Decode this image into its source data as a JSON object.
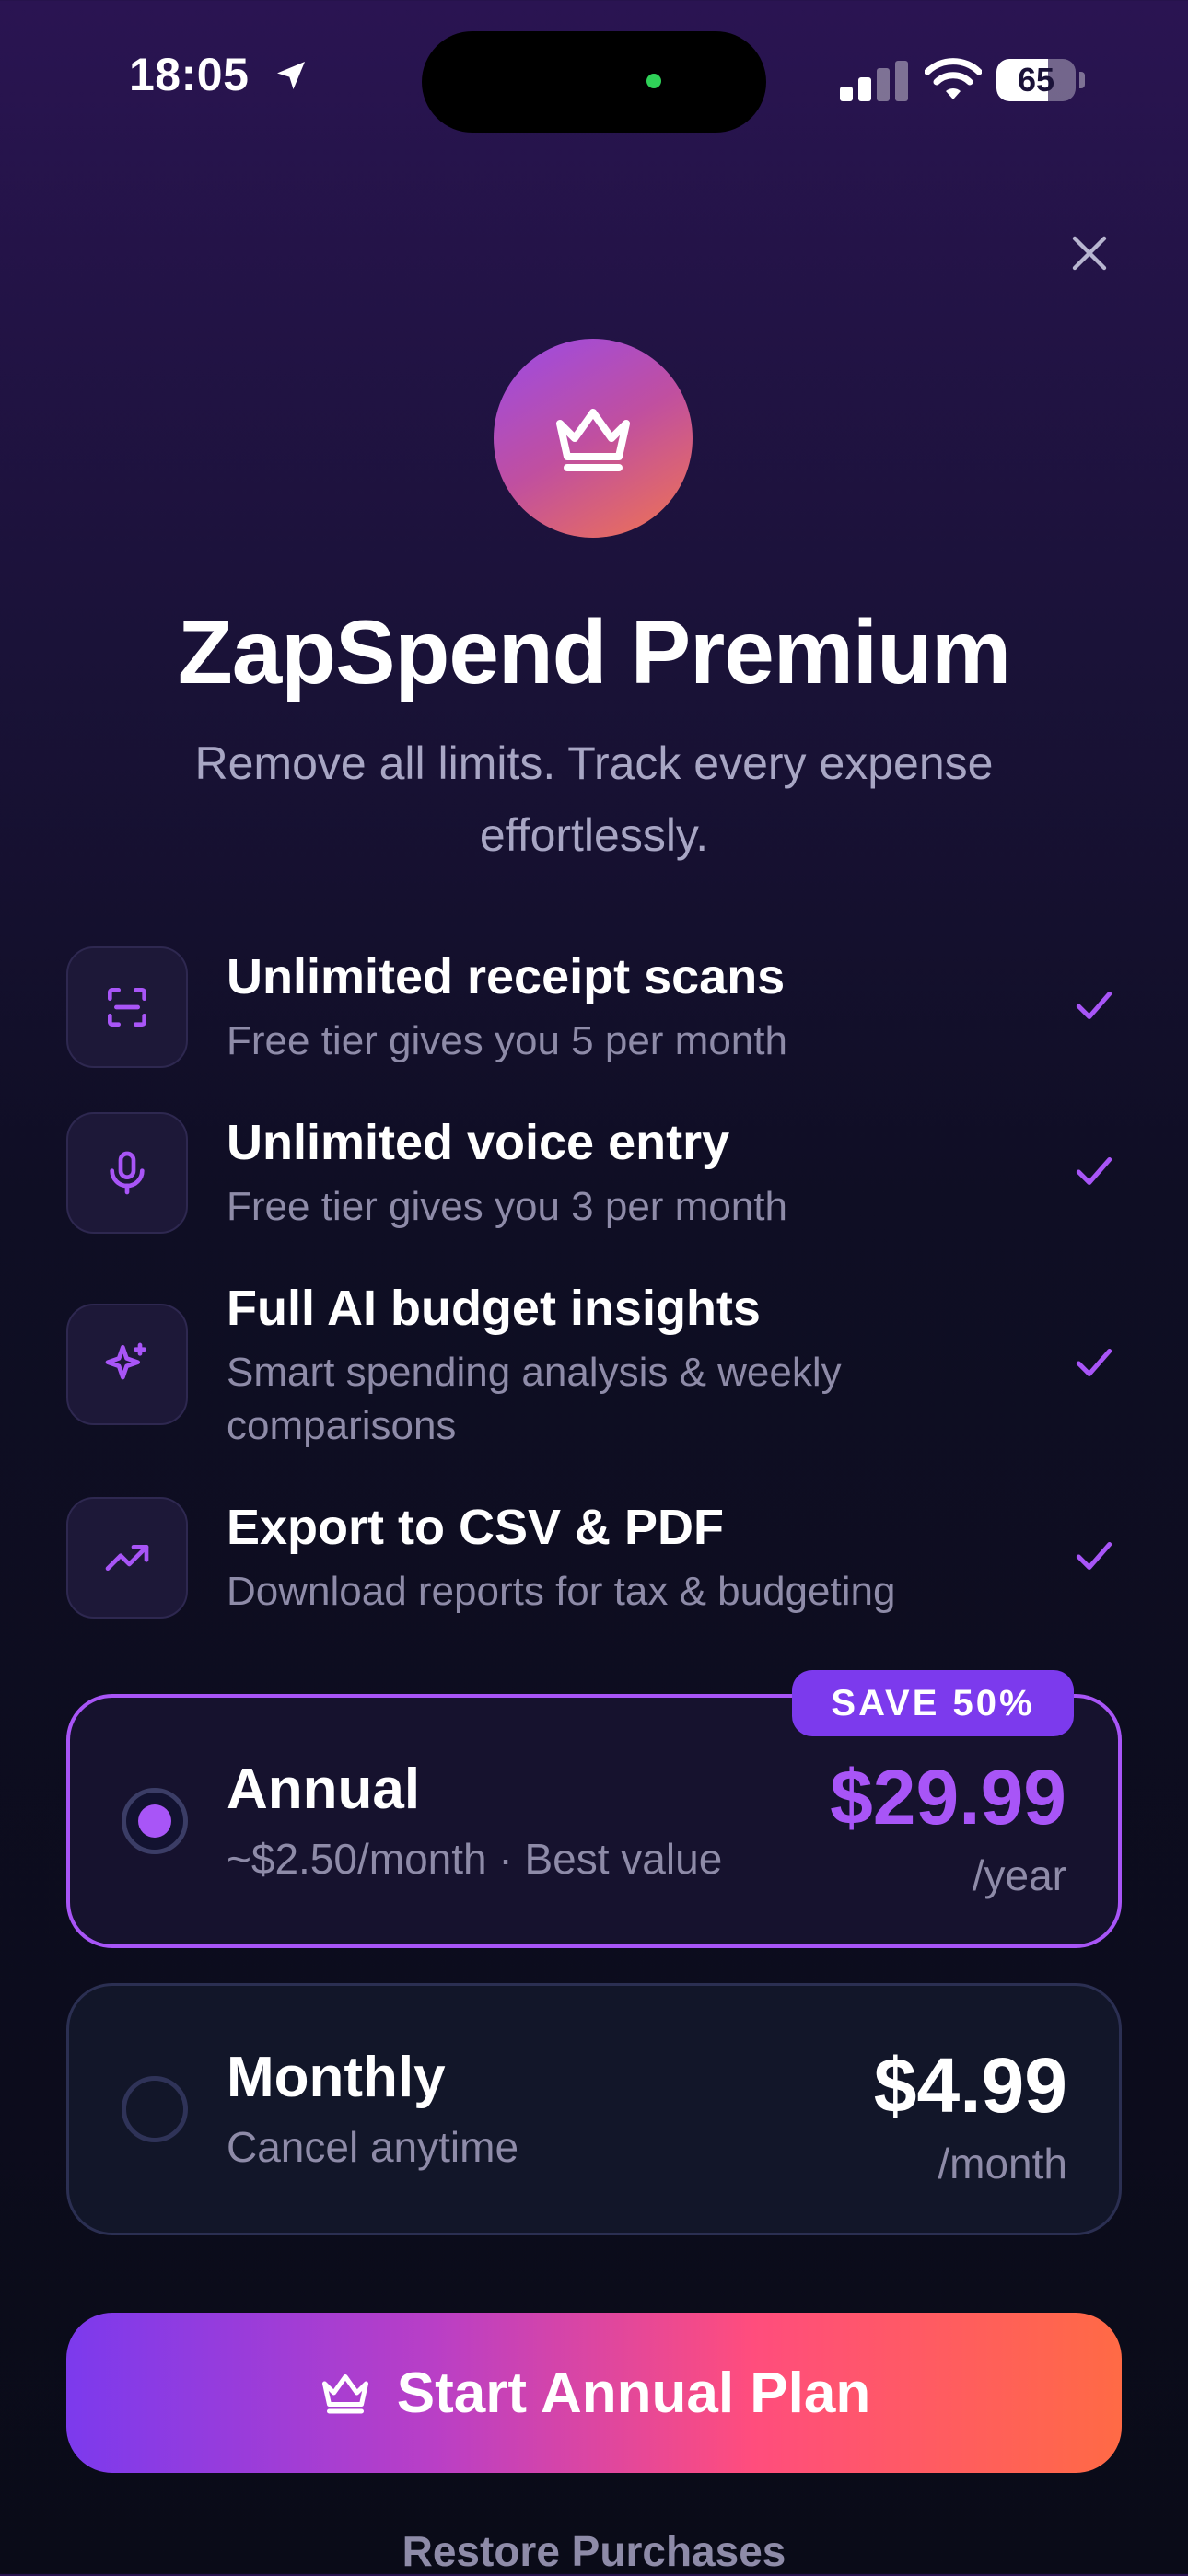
{
  "status_bar": {
    "time": "18:05",
    "battery_level": "65",
    "battery_fraction": 0.65,
    "camera_indicator_color": "#2fd158"
  },
  "header": {
    "close_icon": "close-icon",
    "badge_icon": "crown-icon",
    "title": "ZapSpend Premium",
    "subtitle": "Remove all limits. Track every expense effortlessly."
  },
  "features": [
    {
      "icon": "scan-icon",
      "title": "Unlimited receipt scans",
      "subtitle": "Free tier gives you 5 per month",
      "included": true
    },
    {
      "icon": "microphone-icon",
      "title": "Unlimited voice entry",
      "subtitle": "Free tier gives you 3 per month",
      "included": true
    },
    {
      "icon": "sparkles-icon",
      "title": "Full AI budget insights",
      "subtitle": "Smart spending analysis & weekly comparisons",
      "included": true
    },
    {
      "icon": "trending-up-icon",
      "title": "Export to CSV & PDF",
      "subtitle": "Download reports for tax & budgeting",
      "included": true
    }
  ],
  "plans": {
    "annual": {
      "name": "Annual",
      "description": "~$2.50/month · Best value",
      "price": "$29.99",
      "period": "/year",
      "badge": "SAVE 50%",
      "selected": true
    },
    "monthly": {
      "name": "Monthly",
      "description": "Cancel anytime",
      "price": "$4.99",
      "period": "/month",
      "selected": false
    }
  },
  "cta": {
    "icon": "crown-icon",
    "label": "Start Annual Plan"
  },
  "restore_label": "Restore Purchases",
  "colors": {
    "accent": "#a855f7",
    "badge": "#7c3aed",
    "cta_gradient_start": "#7c3aed",
    "cta_gradient_end": "#ff6a45"
  }
}
